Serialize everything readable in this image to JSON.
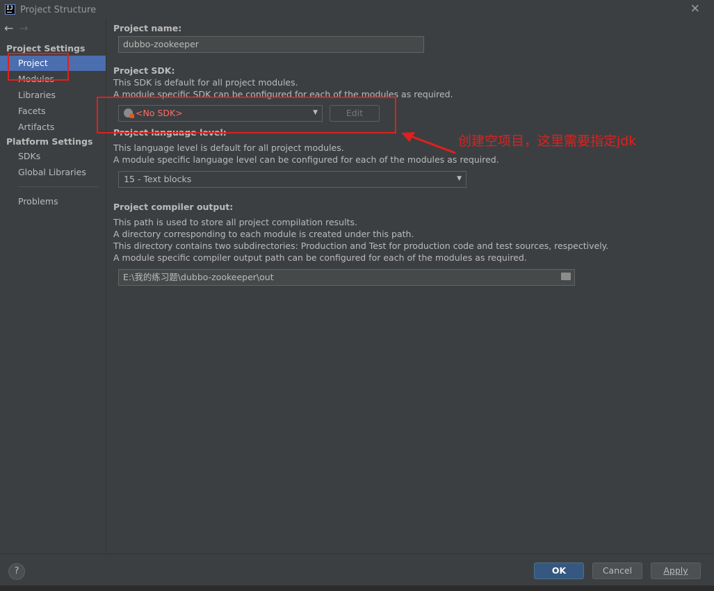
{
  "window": {
    "title": "Project Structure",
    "logo_text": "IJ"
  },
  "sidebar": {
    "sections": [
      {
        "header": "Project Settings",
        "items": [
          {
            "label": "Project",
            "selected": true
          },
          {
            "label": "Modules"
          },
          {
            "label": "Libraries"
          },
          {
            "label": "Facets"
          },
          {
            "label": "Artifacts"
          }
        ]
      },
      {
        "header": "Platform Settings",
        "items": [
          {
            "label": "SDKs"
          },
          {
            "label": "Global Libraries"
          }
        ]
      }
    ],
    "problems": "Problems"
  },
  "main": {
    "project_name": {
      "label": "Project name:",
      "value": "dubbo-zookeeper"
    },
    "project_sdk": {
      "label": "Project SDK:",
      "desc1": "This SDK is default for all project modules.",
      "desc2": "A module specific SDK can be configured for each of the modules as required.",
      "selected": "<No SDK>",
      "edit_label": "Edit"
    },
    "language_level": {
      "label": "Project language level:",
      "desc1": "This language level is default for all project modules.",
      "desc2": "A module specific language level can be configured for each of the modules as required.",
      "selected": "15 - Text blocks"
    },
    "compiler_output": {
      "label": "Project compiler output:",
      "desc1": "This path is used to store all project compilation results.",
      "desc2": "A directory corresponding to each module is created under this path.",
      "desc3": "This directory contains two subdirectories: Production and Test for production code and test sources, respectively.",
      "desc4": "A module specific compiler output path can be configured for each of the modules as required.",
      "path": "E:\\我的练习题\\dubbo-zookeeper\\out"
    }
  },
  "annotation": {
    "text": "创建空项目，这里需要指定jdk",
    "color": "#e0201e"
  },
  "buttons": {
    "help": "?",
    "ok": "OK",
    "cancel": "Cancel",
    "apply": "Apply"
  },
  "colors": {
    "background": "#3c3f41",
    "selection": "#4b6eaf",
    "error_text": "#ff6b68",
    "ok_button": "#365880"
  }
}
